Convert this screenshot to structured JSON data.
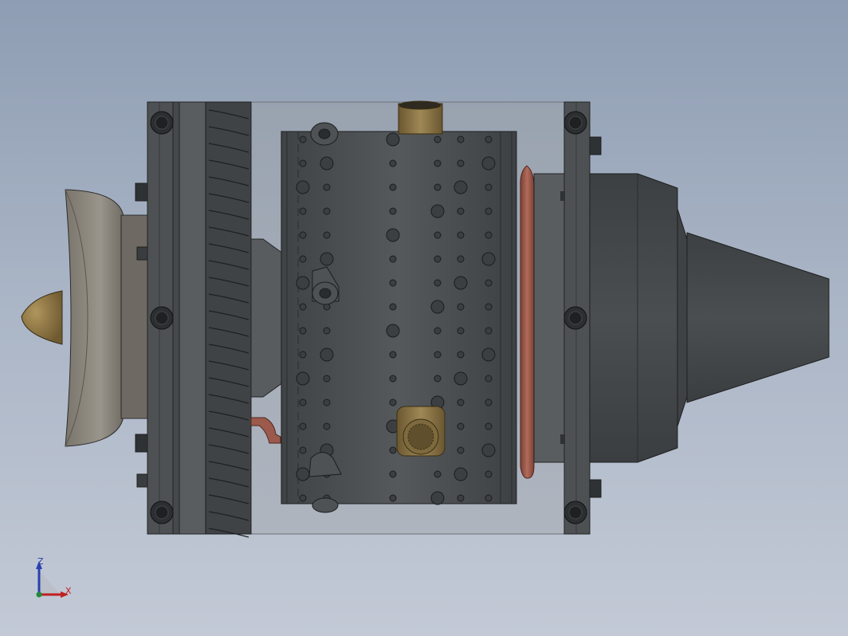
{
  "viewport": {
    "background_top": "#8e9db3",
    "background_bottom": "#c3cad6",
    "model_colors": {
      "housing_dark": "#4a4e50",
      "housing_mid": "#5b5f61",
      "transparent_casing": "#9aa0a6",
      "brass_fitting": "#8a7348",
      "copper_pipe": "#9c5a4c",
      "inlet_bell": "#8f8a80"
    }
  },
  "triad": {
    "z_label": "Z",
    "x_label": "X",
    "z_color": "#2a3fb0",
    "x_color": "#c02020"
  }
}
